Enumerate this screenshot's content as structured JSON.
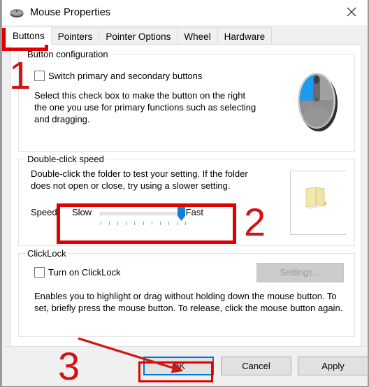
{
  "window": {
    "title": "Mouse Properties",
    "icon": "mouse-icon",
    "close_label": "✕"
  },
  "tabs": [
    {
      "label": "Buttons",
      "active": true
    },
    {
      "label": "Pointers",
      "active": false
    },
    {
      "label": "Pointer Options",
      "active": false
    },
    {
      "label": "Wheel",
      "active": false
    },
    {
      "label": "Hardware",
      "active": false
    }
  ],
  "button_configuration": {
    "group_title": "Button configuration",
    "checkbox_label": "Switch primary and secondary buttons",
    "checkbox_checked": false,
    "description": "Select this check box to make the button on the right the one you use for primary functions such as selecting and dragging.",
    "mouse_graphic": {
      "highlight_color": "#1e9bf0",
      "body_color": "#8f8f8f",
      "shadow_color": "#2b2b2b"
    }
  },
  "double_click_speed": {
    "group_title": "Double-click speed",
    "description": "Double-click the folder to test your setting. If the folder does not open or close, try using a slower setting.",
    "speed_label": "Speed:",
    "slow_label": "Slow",
    "fast_label": "Fast",
    "slider_value_percent": 91,
    "slider_thumb_color": "#0f81d8",
    "tick_count": 11,
    "folder_icon": "folder-icon",
    "folder_color": "#f2dd96"
  },
  "clicklock": {
    "group_title": "ClickLock",
    "checkbox_label": "Turn on ClickLock",
    "checkbox_checked": false,
    "settings_button_label": "Settings...",
    "settings_button_enabled": false,
    "description": "Enables you to highlight or drag without holding down the mouse button. To set, briefly press the mouse button. To release, click the mouse button again."
  },
  "dialog_buttons": {
    "ok": "OK",
    "cancel": "Cancel",
    "apply": "Apply",
    "focus_color": "#0078d7"
  },
  "annotations": {
    "color": "#cf1515",
    "step1": "1",
    "step2": "2",
    "step3": "3",
    "highlight_color": "#e00000"
  }
}
